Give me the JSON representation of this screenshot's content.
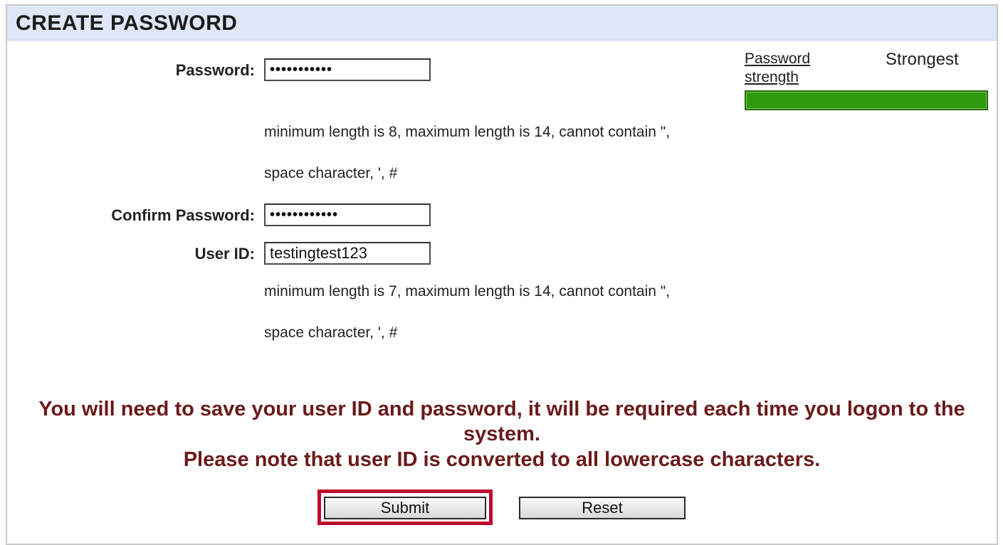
{
  "header": {
    "title": "CREATE PASSWORD"
  },
  "form": {
    "password": {
      "label": "Password:",
      "value": "•••••••••••",
      "hint_line1": "minimum length is 8, maximum length is 14, cannot contain \",",
      "hint_line2": "space character, ', #"
    },
    "confirm_password": {
      "label": "Confirm Password:",
      "value": "••••••••••••"
    },
    "user_id": {
      "label": "User ID:",
      "value": "testingtest123",
      "hint_line1": "minimum length is 7, maximum length is 14, cannot contain \",",
      "hint_line2": "space character, ', #"
    }
  },
  "strength": {
    "link_label": "Password strength",
    "value_label": "Strongest",
    "level_percent": 100,
    "bar_color": "#2f9b0c"
  },
  "notice": {
    "line1": "You will need to save your user ID and password, it will be required each time you logon to the system.",
    "line2": "Please note that user ID is converted to all lowercase characters.",
    "color": "#6b1a1a"
  },
  "buttons": {
    "submit_label": "Submit",
    "reset_label": "Reset",
    "highlight_color": "#c00a2c"
  }
}
